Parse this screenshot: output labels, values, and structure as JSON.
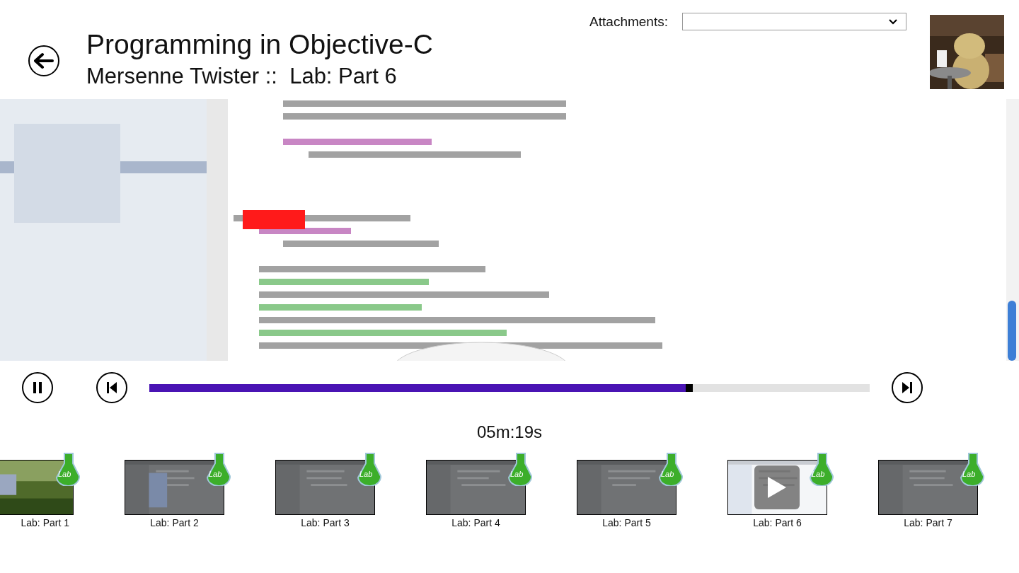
{
  "header": {
    "title": "Programming in Objective-C",
    "subtitle": "Mersenne Twister ::  Lab: Part 6"
  },
  "attachments": {
    "label": "Attachments:"
  },
  "player": {
    "playing": true,
    "level": 0.754,
    "time": "05m:19s"
  },
  "thumbnails": [
    {
      "label": "Lab: Part 1",
      "badge": "Lab",
      "selected": false
    },
    {
      "label": "Lab: Part 2",
      "badge": "Lab",
      "selected": false
    },
    {
      "label": "Lab: Part 3",
      "badge": "Lab",
      "selected": false
    },
    {
      "label": "Lab: Part 4",
      "badge": "Lab",
      "selected": false
    },
    {
      "label": "Lab: Part 5",
      "badge": "Lab",
      "selected": false
    },
    {
      "label": "Lab: Part 6",
      "badge": "Lab",
      "selected": true
    },
    {
      "label": "Lab: Part 7",
      "badge": "Lab",
      "selected": false
    }
  ]
}
